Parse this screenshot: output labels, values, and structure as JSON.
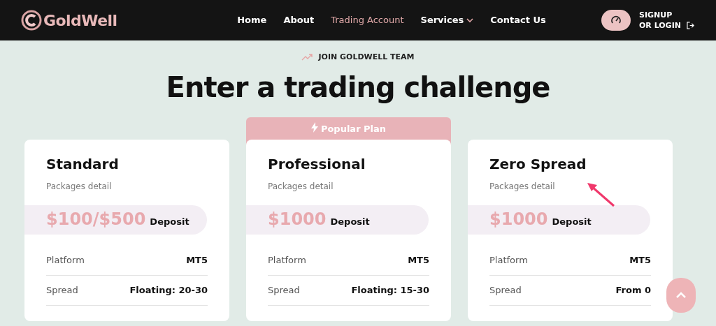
{
  "header": {
    "logo": "GoldWell",
    "nav": [
      {
        "label": "Home",
        "selected": false,
        "dropdown": false
      },
      {
        "label": "About",
        "selected": false,
        "dropdown": false
      },
      {
        "label": "Trading Account",
        "selected": true,
        "dropdown": false
      },
      {
        "label": "Services",
        "selected": false,
        "dropdown": true
      },
      {
        "label": "Contact Us",
        "selected": false,
        "dropdown": false
      }
    ],
    "signup": [
      "SIGNUP",
      "OR LOGIN"
    ]
  },
  "eyebrow": "JOIN GOLDWELL TEAM",
  "title": "Enter a trading challenge",
  "plans": [
    {
      "name": "Standard",
      "subtitle": "Packages detail",
      "price": "$100/$500",
      "price_label": "Deposit",
      "popular": false,
      "rows": [
        {
          "label": "Platform",
          "value": "MT5"
        },
        {
          "label": "Spread",
          "value": "Floating: 20-30"
        }
      ]
    },
    {
      "name": "Professional",
      "subtitle": "Packages detail",
      "price": "$1000",
      "price_label": "Deposit",
      "popular": true,
      "badge": "Popular Plan",
      "rows": [
        {
          "label": "Platform",
          "value": "MT5"
        },
        {
          "label": "Spread",
          "value": "Floating: 15-30"
        }
      ]
    },
    {
      "name": "Zero Spread",
      "subtitle": "Packages detail",
      "price": "$1000",
      "price_label": "Deposit",
      "popular": false,
      "rows": [
        {
          "label": "Platform",
          "value": "MT5"
        },
        {
          "label": "Spread",
          "value": "From 0"
        }
      ]
    }
  ]
}
